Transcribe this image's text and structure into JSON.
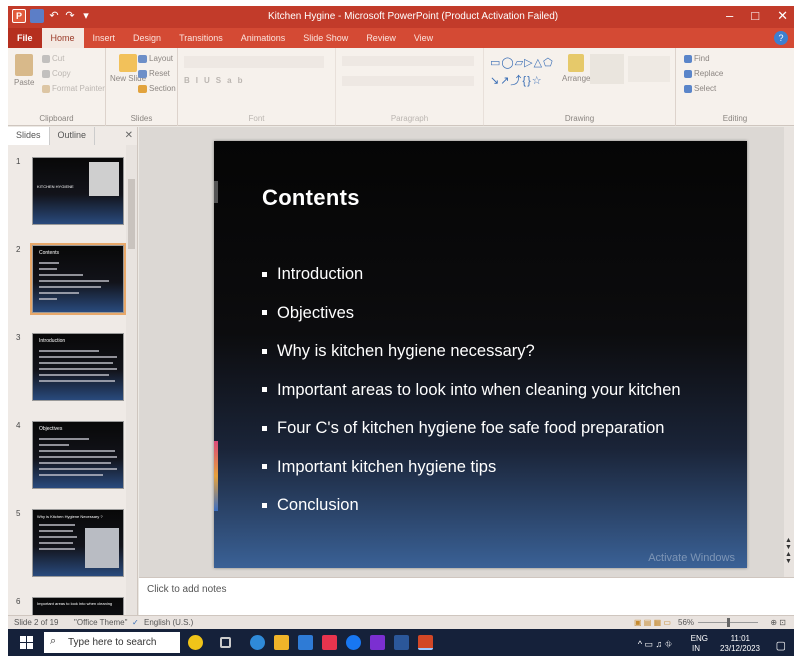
{
  "window": {
    "title": "Kitchen Hygine - Microsoft PowerPoint (Product Activation Failed)",
    "controls": [
      "–",
      "□",
      "✕"
    ]
  },
  "ribbon_tabs": [
    "File",
    "Home",
    "Insert",
    "Design",
    "Transitions",
    "Animations",
    "Slide Show",
    "Review",
    "View"
  ],
  "active_tab": "Home",
  "ribbon": {
    "clipboard": {
      "paste": "Paste",
      "cut": "Cut",
      "copy": "Copy",
      "format_painter": "Format Painter",
      "name": "Clipboard"
    },
    "slides": {
      "new_slide": "New Slide",
      "layout": "Layout",
      "reset": "Reset",
      "section": "Section",
      "name": "Slides"
    },
    "font": {
      "name": "Font"
    },
    "paragraph": {
      "name": "Paragraph"
    },
    "drawing": {
      "arrange": "Arrange",
      "name": "Drawing"
    },
    "editing": {
      "find": "Find",
      "replace": "Replace",
      "select": "Select",
      "name": "Editing"
    }
  },
  "panel": {
    "tab_slides": "Slides",
    "tab_outline": "Outline",
    "close": "✕"
  },
  "thumbnails": [
    {
      "number": "1",
      "caption": "KITCHEN HYGIENE"
    },
    {
      "number": "2",
      "caption": "Contents"
    },
    {
      "number": "3",
      "caption": "Introduction"
    },
    {
      "number": "4",
      "caption": "Objectives"
    },
    {
      "number": "5",
      "caption": "Why is Kitchen Hygiene Necessary ?"
    },
    {
      "number": "6",
      "caption": "Important areas to look into when cleaning"
    }
  ],
  "slide": {
    "title": "Contents",
    "bullets": [
      "Introduction",
      "Objectives",
      "Why is kitchen hygiene necessary?",
      "Important areas to look into when cleaning your kitchen",
      "Four C's of kitchen hygiene foe safe food preparation",
      "Important kitchen hygiene tips",
      "Conclusion"
    ],
    "watermark": "Activate Windows"
  },
  "notes_placeholder": "Click to add notes",
  "status": {
    "slide_info": "Slide 2 of 19",
    "theme": "\"Office Theme\"",
    "language": "English (U.S.)",
    "zoom": "56%"
  },
  "taskbar": {
    "search_placeholder": "Type here to search",
    "lang1": "ENG",
    "lang2": "IN",
    "time": "11:01",
    "date": "23/12/2023"
  }
}
